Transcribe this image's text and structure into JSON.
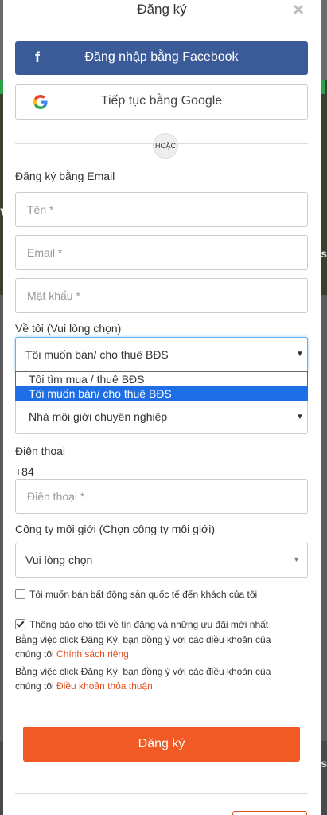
{
  "modal": {
    "title": "Đăng ký",
    "close": "×"
  },
  "social": {
    "facebook_label": "Đăng nhập bằng Facebook",
    "facebook_icon": "f",
    "google_label": "Tiếp tục bằng Google"
  },
  "divider": {
    "or_text": "HOẶC"
  },
  "email_section": {
    "heading": "Đăng ký bằng Email",
    "name_placeholder": "Tên *",
    "email_placeholder": "Email *",
    "password_placeholder": "Mật khẩu *"
  },
  "about": {
    "label": "Về tôi (Vui lòng chọn)",
    "selected": "Tôi muốn bán/ cho thuê BĐS",
    "options": [
      "Tôi tìm mua / thuê BĐS",
      "Tôi muốn bán/ cho thuê BĐS",
      "Nhà môi giới chuyên nghiệp"
    ],
    "highlighted_index": 1
  },
  "phone": {
    "label": "Điện thoại",
    "prefix": "+84",
    "placeholder": "Điện thoại *"
  },
  "company": {
    "label": "Công ty môi giới (Chọn công ty môi giới)",
    "selected": "Vui lòng chọn"
  },
  "checkboxes": {
    "international": {
      "label": "Tôi muốn bán bất động sản quốc tế đến khách của tôi",
      "checked": false
    },
    "notify": {
      "label": "Thông báo cho tôi về tin đăng và những ưu đãi mới nhất",
      "checked": true
    }
  },
  "terms": {
    "line1_prefix": "Bằng việc click Đăng Ký, bạn đồng ý với các điều khoản của chúng tôi",
    "line1_link": "Chính sách riêng",
    "line2_prefix": "Bằng việc click Đăng Ký, bạn đồng ý với các điều khoản của chúng tôi",
    "line2_link": "Điều khoản thỏa thuận"
  },
  "submit": {
    "label": "Đăng ký"
  },
  "backdrop": {
    "text_left": "V",
    "text_right": "s",
    "text_right2": "es"
  },
  "colors": {
    "facebook": "#3b5b98",
    "submit": "#f15a24",
    "link": "#e84c1e",
    "dropdown_highlight": "#1e6fe6"
  }
}
